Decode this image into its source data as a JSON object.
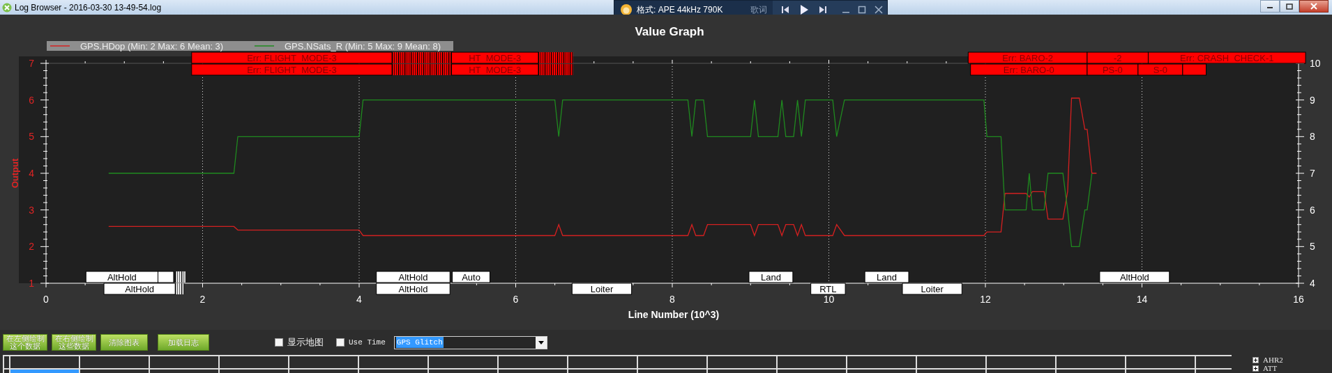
{
  "window": {
    "title": "Log Browser - 2016-03-30 13-49-54.log"
  },
  "player": {
    "format_text": "格式: APE 44kHz 790K",
    "lyrics_label": "歌词"
  },
  "graph": {
    "chart_data": {
      "type": "line",
      "title": "Value Graph",
      "xlabel": "Line Number (10^3)",
      "ylabel": "Output",
      "x": [
        0.8,
        2.4,
        2.45,
        4.0,
        4.05,
        6.5,
        6.55,
        6.6,
        8.2,
        8.25,
        8.3,
        8.4,
        8.45,
        9.0,
        9.05,
        9.1,
        9.35,
        9.4,
        9.45,
        9.55,
        9.6,
        9.65,
        9.7,
        10.05,
        10.1,
        10.2,
        11.98,
        12.02,
        12.2,
        12.25,
        12.52,
        12.56,
        12.6,
        12.75,
        12.8,
        12.99,
        13.05,
        13.1,
        13.2,
        13.27,
        13.3,
        13.36,
        13.42
      ],
      "series": [
        {
          "name": "GPS.HDop (Min: 2 Max: 6 Mean: 3)",
          "color": "#d42020",
          "values": [
            2.55,
            2.55,
            2.45,
            2.45,
            2.3,
            2.3,
            2.6,
            2.3,
            2.3,
            2.6,
            2.3,
            2.3,
            2.6,
            2.6,
            2.3,
            2.6,
            2.6,
            2.3,
            2.6,
            2.6,
            2.3,
            2.6,
            2.3,
            2.3,
            2.6,
            2.3,
            2.3,
            2.4,
            2.4,
            3.45,
            3.45,
            3.35,
            3.5,
            3.5,
            2.75,
            2.75,
            3.5,
            6.05,
            6.05,
            5.2,
            5.2,
            4.0,
            4.0
          ]
        },
        {
          "name": "GPS.NSats_R (Min: 5 Max: 9 Mean: 8)",
          "color": "#1f8a1f",
          "axis": "y2",
          "values": [
            7,
            7,
            8,
            8,
            9,
            9,
            8,
            9,
            9,
            8,
            9,
            9,
            8,
            8,
            9,
            8,
            8,
            9,
            8,
            8,
            9,
            8,
            9,
            9,
            8,
            9,
            9,
            8,
            8,
            6,
            6,
            7,
            6,
            6,
            7,
            7,
            6,
            5,
            5,
            6,
            6,
            7,
            null
          ]
        }
      ],
      "xlim": [
        0,
        16
      ],
      "ylim": [
        1,
        7
      ],
      "y2lim": [
        4,
        10
      ],
      "xticks": [
        0,
        2,
        4,
        6,
        8,
        10,
        12,
        14,
        16
      ],
      "yticks": [
        1,
        2,
        3,
        4,
        5,
        6,
        7
      ],
      "y2ticks": [
        4,
        5,
        6,
        7,
        8,
        9,
        10
      ],
      "grid": true,
      "legend": "upper left"
    },
    "events": [
      {
        "kind": "error",
        "text": "Err: FLIGHT_MODE-3"
      },
      {
        "kind": "burst"
      },
      {
        "kind": "error",
        "text": "HT_MODE-3"
      },
      {
        "kind": "burst"
      },
      {
        "kind": "error",
        "text": "Err: FLIGHT_MODE-3"
      },
      {
        "kind": "burst"
      },
      {
        "kind": "error",
        "text": "HT_MODE-3"
      },
      {
        "kind": "burst"
      },
      {
        "kind": "error",
        "text": "Err: BARO-2"
      },
      {
        "kind": "error",
        "text": "-2"
      },
      {
        "kind": "error",
        "text": "Err: CRASH_CHECK-1"
      },
      {
        "kind": "error",
        "text": "Err: BARO-0"
      },
      {
        "kind": "error",
        "text": "PS-0"
      },
      {
        "kind": "error",
        "text": "S-0"
      },
      {
        "kind": "blank"
      },
      {
        "kind": "mode",
        "text": "AltHold"
      },
      {
        "kind": "blank_mode"
      },
      {
        "kind": "mode_burst"
      },
      {
        "kind": "mode",
        "text": "AltHold"
      },
      {
        "kind": "mode",
        "text": "Auto"
      },
      {
        "kind": "mode",
        "text": "Land"
      },
      {
        "kind": "mode",
        "text": "Land"
      },
      {
        "kind": "mode",
        "text": "AltHold"
      },
      {
        "kind": "mode",
        "text": "AltHold"
      },
      {
        "kind": "mode_burst"
      },
      {
        "kind": "mode",
        "text": "AltHold"
      },
      {
        "kind": "mode",
        "text": "Loiter"
      },
      {
        "kind": "mode",
        "text": "RTL"
      },
      {
        "kind": "mode",
        "text": "Loiter"
      }
    ]
  },
  "toolbar": {
    "buttons": [
      {
        "label": "在左侧绘制这个数据"
      },
      {
        "label": "在右侧绘制这些数据"
      },
      {
        "label": "清除图表"
      },
      {
        "label": "加载日志"
      }
    ],
    "checkboxes": [
      {
        "label": "显示地图",
        "checked": false,
        "kind": "cjk"
      },
      {
        "label": "Use Time",
        "checked": false,
        "kind": "mono"
      }
    ],
    "message_type": {
      "value": "GPS Glitch",
      "focused": true
    }
  },
  "log_grid": {
    "row_selected": true
  },
  "tree": {
    "items": [
      {
        "label": "AHR2",
        "expanded": false
      },
      {
        "label": "ATT",
        "expanded": false
      }
    ]
  }
}
